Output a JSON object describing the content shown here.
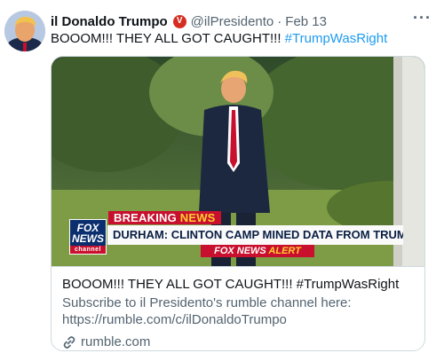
{
  "tweet": {
    "display_name": "il Donaldo Trumpo",
    "verified_badge": "V",
    "handle": "@ilPresidento",
    "separator": "·",
    "date": "Feb 13",
    "more_icon": "ellipsis-icon",
    "text_main": "BOOOM!!! THEY ALL GOT CAUGHT!!! ",
    "hashtag": "#TrumpWasRight",
    "badge_color": "#d62d20",
    "link_color": "#1d9bf0"
  },
  "card": {
    "video_overlay": {
      "breaking_label": "BREAKING ",
      "breaking_news_word": "NEWS",
      "logo_line1": "FOX",
      "logo_line2": "NEWS",
      "logo_line3": "channel",
      "headline": "DURHAM: CLINTON CAMP MINED DATA FROM TRUMP SERVERS",
      "alert_brand": "FOX NEWS ",
      "alert_word": "ALERT",
      "brand_red": "#c8102e",
      "brand_navy": "#0a2e6e"
    },
    "title": "BOOOM!!! THEY ALL GOT CAUGHT!!! #TrumpWasRight",
    "description": "Subscribe to il Presidento's rumble channel here: https://rumble.com/c/ilDonaldoTrumpo",
    "domain": "rumble.com",
    "domain_icon": "link-icon"
  }
}
